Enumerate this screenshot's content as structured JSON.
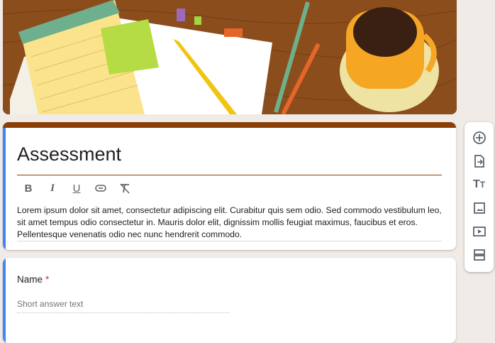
{
  "form": {
    "title": "Assessment",
    "description": "Lorem ipsum dolor sit amet, consectetur adipiscing elit. Curabitur quis sem odio. Sed commodo vestibulum leo, sit amet tempus odio consectetur in. Mauris dolor elit, dignissim mollis feugiat maximus, faucibus et eros. Pellentesque venenatis odio nec nunc hendrerit commodo.",
    "theme_color": "#8b3f06",
    "accent_color": "#4285f4"
  },
  "format_toolbar": [
    "bold-icon",
    "italic-icon",
    "underline-icon",
    "link-icon",
    "clear-format-icon"
  ],
  "question": {
    "label": "Name",
    "required_mark": "*",
    "placeholder": "Short answer text"
  },
  "side_toolbar": [
    "add-question-icon",
    "import-questions-icon",
    "add-title-icon",
    "add-image-icon",
    "add-video-icon",
    "add-section-icon"
  ]
}
